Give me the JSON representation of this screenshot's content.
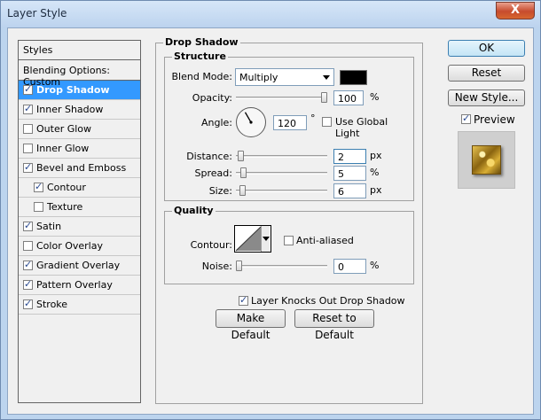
{
  "window": {
    "title": "Layer Style",
    "close_glyph": "X"
  },
  "styles_panel": {
    "header": "Styles",
    "blending_options": "Blending Options: Custom",
    "items": [
      {
        "label": "Drop Shadow",
        "checked": true,
        "selected": true,
        "indent": false
      },
      {
        "label": "Inner Shadow",
        "checked": true,
        "selected": false,
        "indent": false
      },
      {
        "label": "Outer Glow",
        "checked": false,
        "selected": false,
        "indent": false
      },
      {
        "label": "Inner Glow",
        "checked": false,
        "selected": false,
        "indent": false
      },
      {
        "label": "Bevel and Emboss",
        "checked": true,
        "selected": false,
        "indent": false
      },
      {
        "label": "Contour",
        "checked": true,
        "selected": false,
        "indent": true
      },
      {
        "label": "Texture",
        "checked": false,
        "selected": false,
        "indent": true
      },
      {
        "label": "Satin",
        "checked": true,
        "selected": false,
        "indent": false
      },
      {
        "label": "Color Overlay",
        "checked": false,
        "selected": false,
        "indent": false
      },
      {
        "label": "Gradient Overlay",
        "checked": true,
        "selected": false,
        "indent": false
      },
      {
        "label": "Pattern Overlay",
        "checked": true,
        "selected": false,
        "indent": false
      },
      {
        "label": "Stroke",
        "checked": true,
        "selected": false,
        "indent": false
      }
    ]
  },
  "drop_shadow": {
    "title": "Drop Shadow",
    "structure": {
      "title": "Structure",
      "blend_mode_label": "Blend Mode:",
      "blend_mode_value": "Multiply",
      "shadow_color": "#000000",
      "opacity_label": "Opacity:",
      "opacity_value": "100",
      "opacity_fraction": 1.0,
      "opacity_unit": "%",
      "angle_label": "Angle:",
      "angle_value": "120",
      "angle_degrees": 120,
      "angle_unit": "°",
      "use_global_light_label": "Use Global Light",
      "use_global_light_checked": false,
      "distance_label": "Distance:",
      "distance_value": "2",
      "distance_fraction": 0.02,
      "distance_unit": "px",
      "spread_label": "Spread:",
      "spread_value": "5",
      "spread_fraction": 0.05,
      "spread_unit": "%",
      "size_label": "Size:",
      "size_value": "6",
      "size_fraction": 0.04,
      "size_unit": "px"
    },
    "quality": {
      "title": "Quality",
      "contour_label": "Contour:",
      "anti_aliased_label": "Anti-aliased",
      "anti_aliased_checked": false,
      "noise_label": "Noise:",
      "noise_value": "0",
      "noise_fraction": 0.0,
      "noise_unit": "%"
    },
    "knockout_label": "Layer Knocks Out Drop Shadow",
    "knockout_checked": true,
    "make_default_label": "Make Default",
    "reset_default_label": "Reset to Default"
  },
  "side_buttons": {
    "ok": "OK",
    "reset": "Reset",
    "new_style": "New Style...",
    "preview_label": "Preview",
    "preview_checked": true
  },
  "colors": {
    "selection": "#3399ff",
    "dialog_bg": "#f0f0f0",
    "title_bg": "#bcd3ee",
    "close_red": "#c74b2d"
  }
}
